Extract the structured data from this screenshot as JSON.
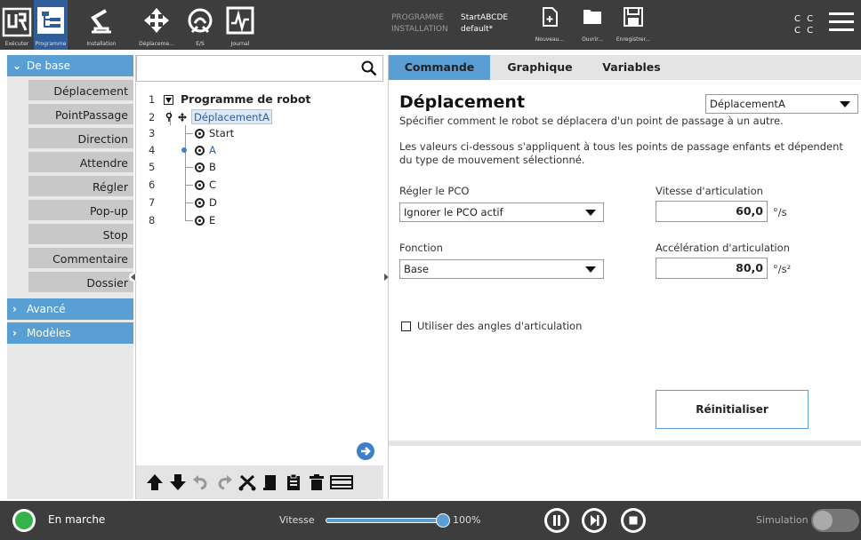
{
  "nav": {
    "tabs": [
      {
        "label": "Exécuter",
        "icon": "ur-logo-icon"
      },
      {
        "label": "Programme",
        "icon": "program-tree-icon",
        "active": true
      },
      {
        "label": "Installation",
        "icon": "robot-arm-icon"
      },
      {
        "label": "Déplaceme...",
        "icon": "move-arrows-icon"
      },
      {
        "label": "E/S",
        "icon": "io-icon"
      },
      {
        "label": "Journal",
        "icon": "log-chart-icon"
      }
    ]
  },
  "program_info": {
    "program_key": "PROGRAMME",
    "program_value": "StartABCDE",
    "installation_key": "INSTALLATION",
    "installation_value": "default*"
  },
  "file_buttons": {
    "new": "Nouveau...",
    "open": "Ouvrir...",
    "save": "Enregistrer..."
  },
  "cc": {
    "line1": "C C",
    "line2": "C C"
  },
  "sidebar": {
    "basic_label": "De base",
    "items": [
      "Déplacement",
      "PointPassage",
      "Direction",
      "Attendre",
      "Régler",
      "Pop-up",
      "Stop",
      "Commentaire",
      "Dossier"
    ],
    "advanced_label": "Avancé",
    "templates_label": "Modèles"
  },
  "tree": {
    "search_placeholder": "",
    "rows": [
      {
        "num": "1",
        "label": "Programme de robot"
      },
      {
        "num": "2",
        "label": "DéplacementA"
      },
      {
        "num": "3",
        "label": "Start"
      },
      {
        "num": "4",
        "label": "A"
      },
      {
        "num": "5",
        "label": "B"
      },
      {
        "num": "6",
        "label": "C"
      },
      {
        "num": "7",
        "label": "D"
      },
      {
        "num": "8",
        "label": "E"
      }
    ]
  },
  "tabs": [
    "Commande",
    "Graphique",
    "Variables"
  ],
  "panel": {
    "title": "Déplacement",
    "move_select": "DéplacementA",
    "description1": "Spécifier comment le robot se déplacera d'un point de passage à un autre.",
    "description2": "Les valeurs ci-dessous s'appliquent à tous les points de passage enfants et dépendent du type de mouvement sélectionné.",
    "tcp_label": "Régler le PCO",
    "tcp_value": "Ignorer le PCO actif",
    "function_label": "Fonction",
    "function_value": "Base",
    "joint_speed_label": "Vitesse d'articulation",
    "joint_speed_value": "60,0",
    "joint_speed_unit": "°/s",
    "joint_accel_label": "Accélération d'articulation",
    "joint_accel_value": "80,0",
    "joint_accel_unit": "°/s²",
    "joint_angles_label": "Utiliser des angles d'articulation",
    "reset_label": "Réinitialiser"
  },
  "bottom": {
    "status": "En marche",
    "speed_label": "Vitesse",
    "speed_value": "100%",
    "speed_fraction": 1.0,
    "sim_label": "Simulation"
  },
  "colors": {
    "accent": "#5a9fd4",
    "header": "#3d3d3d",
    "running": "#35b34a"
  }
}
